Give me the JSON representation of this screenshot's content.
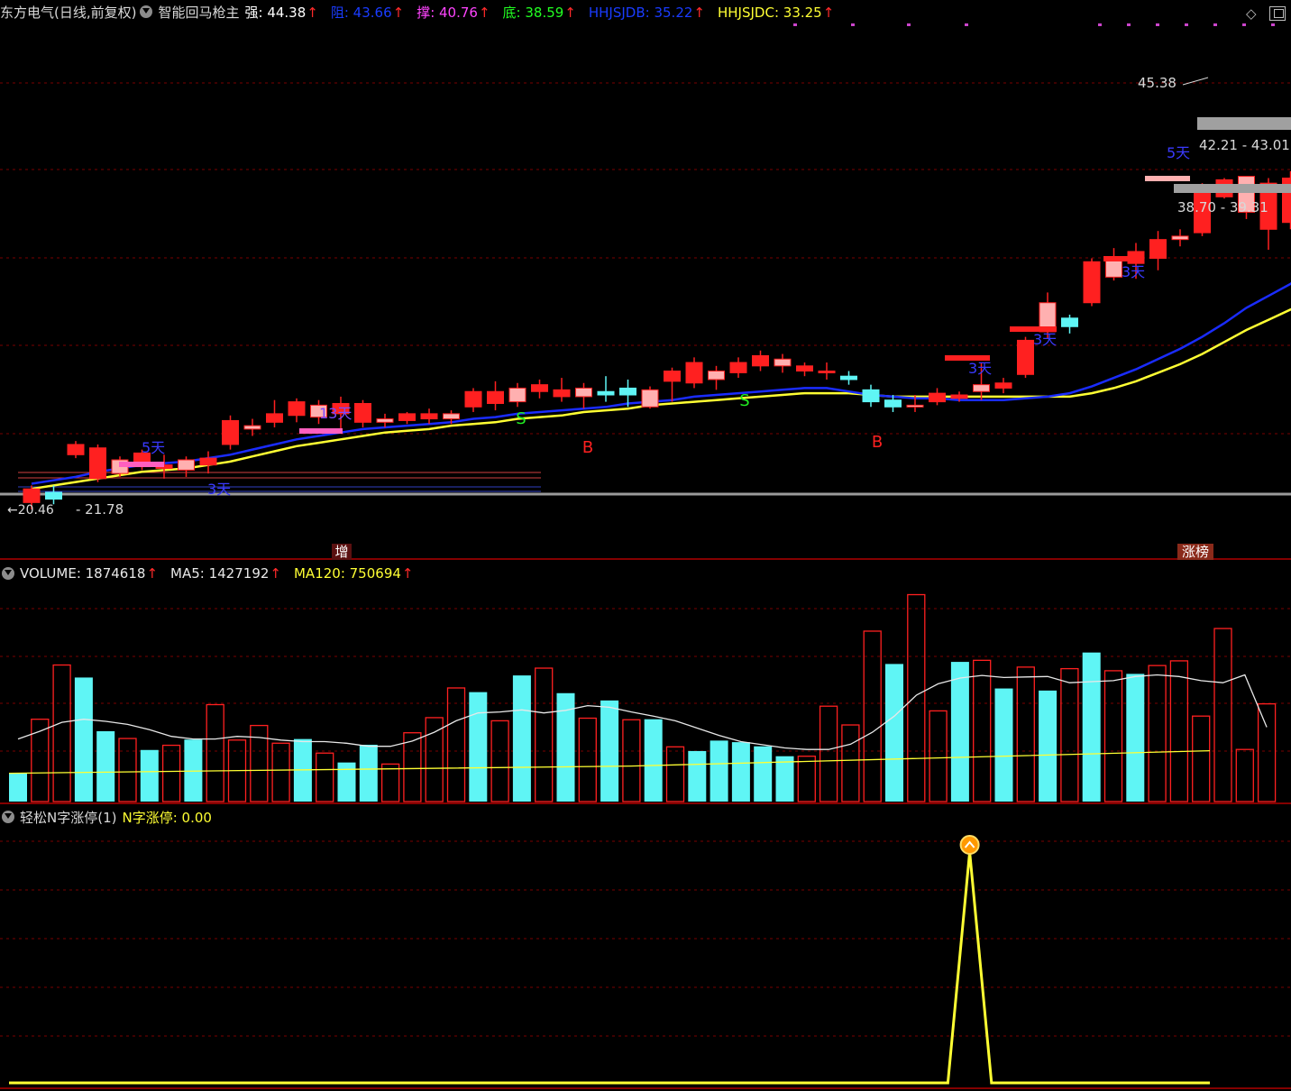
{
  "header": {
    "title": "东方电气(日线,前复权)",
    "indicator": "智能回马枪主",
    "items": [
      {
        "label": "强",
        "value": "44.38",
        "color": "#ffffff"
      },
      {
        "label": "阻",
        "value": "43.66",
        "color": "#1a3cff"
      },
      {
        "label": "撑",
        "value": "40.76",
        "color": "#ff44ff"
      },
      {
        "label": "底",
        "value": "38.59",
        "color": "#22ff22"
      },
      {
        "label": "HHJSJDB",
        "value": "35.22",
        "color": "#1a3cff"
      },
      {
        "label": "HHJSJDC",
        "value": "33.25",
        "color": "#ffff33"
      }
    ]
  },
  "volume_header": {
    "items": [
      {
        "label": "VOLUME",
        "value": "1874618",
        "color": "#e8e8e8"
      },
      {
        "label": "MA5",
        "value": "1427192",
        "color": "#e8e8e8"
      },
      {
        "label": "MA120",
        "value": "750694",
        "color": "#ffff33"
      }
    ]
  },
  "indicator_header": {
    "name": "轻松N字涨停(1)",
    "label": "N字涨停",
    "value": "0.00"
  },
  "annotations": {
    "high_price": "45.38",
    "low_price": "21.78",
    "low_price_overlap": "20.46",
    "zone_upper": "42.21 - 43.01",
    "zone_lower": "38.70 - 39.31",
    "day_labels": [
      "5天",
      "13天",
      "3天",
      "3天",
      "3天",
      "3天",
      "5天"
    ],
    "signals_b": [
      "B",
      "B"
    ],
    "signals_s": [
      "S",
      "S"
    ],
    "tag_zeng": "增",
    "tag_zhangbang": "涨榜"
  },
  "colors": {
    "up": "#ff2020",
    "up_light": "#ffb0b0",
    "down": "#5ff5f5",
    "ma_blue": "#1a2cff",
    "ma_yellow": "#ffff33",
    "grid": "#7a0000",
    "separator": "#b00000"
  },
  "icons": [
    "collapse-circle-icon",
    "diamond-icon",
    "maximize-icon",
    "up-arrow-icon"
  ],
  "chart_data": [
    {
      "type": "candlestick",
      "series": [
        {
          "name": "K线",
          "values": [
            [
              20.6,
              21.4,
              20.2,
              21.6
            ],
            [
              21.2,
              20.8,
              20.5,
              21.6
            ],
            [
              23.4,
              24.0,
              23.2,
              24.2
            ],
            [
              22.0,
              23.8,
              21.8,
              24.0
            ],
            [
              22.3,
              23.1,
              22.1,
              23.3
            ],
            [
              22.7,
              23.5,
              22.5,
              23.7
            ],
            [
              22.6,
              22.8,
              22.0,
              23.4
            ],
            [
              22.5,
              23.1,
              22.1,
              23.3
            ],
            [
              22.8,
              23.2,
              22.3,
              23.6
            ],
            [
              24.0,
              25.4,
              23.7,
              25.7
            ],
            [
              24.9,
              25.1,
              24.5,
              25.5
            ],
            [
              25.3,
              25.8,
              25.0,
              26.6
            ],
            [
              25.7,
              26.5,
              25.3,
              26.7
            ],
            [
              25.6,
              26.3,
              25.2,
              26.6
            ],
            [
              25.8,
              26.4,
              24.9,
              26.8
            ],
            [
              25.3,
              26.4,
              25.0,
              26.6
            ],
            [
              25.3,
              25.5,
              25.0,
              25.8
            ],
            [
              25.4,
              25.8,
              25.2,
              25.9
            ],
            [
              25.5,
              25.8,
              25.2,
              26.1
            ],
            [
              25.5,
              25.8,
              25.2,
              26.0
            ],
            [
              26.2,
              27.1,
              25.9,
              27.3
            ],
            [
              26.4,
              27.1,
              26.0,
              27.7
            ],
            [
              26.5,
              27.3,
              26.2,
              27.6
            ],
            [
              27.1,
              27.5,
              26.7,
              27.8
            ],
            [
              26.8,
              27.2,
              26.5,
              27.9
            ],
            [
              26.8,
              27.3,
              26.1,
              27.6
            ],
            [
              27.1,
              26.9,
              26.5,
              28.0
            ],
            [
              27.3,
              26.9,
              26.2,
              27.8
            ],
            [
              26.2,
              27.2,
              26.1,
              27.4
            ],
            [
              27.7,
              28.3,
              26.5,
              28.5
            ],
            [
              27.6,
              28.8,
              27.3,
              29.1
            ],
            [
              27.8,
              28.3,
              27.2,
              28.6
            ],
            [
              28.2,
              28.8,
              27.9,
              29.1
            ],
            [
              28.6,
              29.2,
              28.3,
              29.5
            ],
            [
              28.6,
              29.0,
              28.2,
              29.3
            ],
            [
              28.3,
              28.6,
              28.0,
              28.8
            ],
            [
              28.3,
              28.3,
              27.8,
              28.8
            ],
            [
              28.0,
              27.8,
              27.5,
              28.3
            ],
            [
              27.2,
              26.5,
              26.2,
              27.5
            ],
            [
              26.6,
              26.2,
              25.9,
              26.9
            ],
            [
              26.3,
              26.3,
              25.9,
              26.9
            ],
            [
              26.5,
              27.0,
              26.3,
              27.3
            ],
            [
              26.7,
              26.9,
              26.5,
              27.1
            ],
            [
              27.1,
              27.5,
              26.6,
              28.8
            ],
            [
              27.3,
              27.6,
              27.0,
              27.9
            ],
            [
              28.1,
              30.1,
              27.9,
              30.3
            ],
            [
              30.6,
              32.3,
              30.2,
              32.9
            ],
            [
              31.4,
              30.9,
              30.5,
              31.6
            ],
            [
              32.3,
              34.7,
              32.1,
              34.9
            ],
            [
              33.8,
              35.0,
              33.6,
              35.5
            ],
            [
              34.6,
              35.3,
              33.7,
              35.8
            ],
            [
              34.9,
              36.0,
              34.2,
              36.5
            ],
            [
              36.0,
              36.2,
              35.6,
              36.6
            ],
            [
              36.4,
              39.1,
              36.2,
              39.3
            ],
            [
              38.5,
              39.5,
              38.4,
              39.6
            ],
            [
              37.6,
              39.7,
              37.2,
              39.7
            ],
            [
              36.6,
              39.3,
              35.4,
              39.6
            ],
            [
              37.0,
              39.6,
              36.6,
              40.0
            ],
            [
              37.2,
              39.8,
              37.0,
              40.1
            ],
            [
              41.6,
              43.8,
              41.5,
              44.0
            ],
            [
              43.2,
              44.5,
              43.1,
              45.4
            ]
          ]
        }
      ],
      "ma_blue": [
        21.7,
        21.9,
        22.1,
        22.4,
        22.6,
        22.8,
        22.9,
        23.0,
        23.2,
        23.4,
        23.7,
        24.0,
        24.3,
        24.5,
        24.7,
        24.9,
        25.0,
        25.1,
        25.2,
        25.3,
        25.5,
        25.6,
        25.8,
        25.9,
        26.0,
        26.1,
        26.2,
        26.4,
        26.5,
        26.6,
        26.8,
        26.9,
        27.0,
        27.1,
        27.2,
        27.3,
        27.3,
        27.1,
        26.9,
        26.8,
        26.7,
        26.7,
        26.6,
        26.6,
        26.6,
        26.7,
        26.8,
        27.0,
        27.4,
        27.9,
        28.4,
        29.0,
        29.6,
        30.3,
        31.1,
        32.0,
        32.7,
        33.4,
        34.4,
        35.2
      ],
      "ma_yellow": [
        21.4,
        21.6,
        21.8,
        22.0,
        22.2,
        22.4,
        22.5,
        22.6,
        22.8,
        23.0,
        23.3,
        23.6,
        23.9,
        24.1,
        24.3,
        24.5,
        24.7,
        24.8,
        24.9,
        25.1,
        25.2,
        25.3,
        25.5,
        25.6,
        25.7,
        25.9,
        26.0,
        26.1,
        26.3,
        26.4,
        26.5,
        26.6,
        26.7,
        26.8,
        26.9,
        27.0,
        27.0,
        27.0,
        26.9,
        26.8,
        26.8,
        26.8,
        26.8,
        26.8,
        26.8,
        26.8,
        26.8,
        26.8,
        27.0,
        27.3,
        27.7,
        28.2,
        28.7,
        29.3,
        30.0,
        30.7,
        31.3,
        31.9,
        32.6,
        33.3
      ],
      "ylim": [
        20.46,
        45.38
      ]
    },
    {
      "type": "bar",
      "title": "VOLUME",
      "series": [
        {
          "name": "VOLUME",
          "values": [
            550000,
            1580000,
            2620000,
            2380000,
            1350000,
            1210000,
            990000,
            1080000,
            1190000,
            1860000,
            1180000,
            1460000,
            1120000,
            1200000,
            930000,
            750000,
            1090000,
            720000,
            1320000,
            1610000,
            2180000,
            2100000,
            1550000,
            2420000,
            2560000,
            2080000,
            1600000,
            1940000,
            1570000,
            1580000,
            1050000,
            970000,
            1170000,
            1140000,
            1060000,
            870000,
            870000,
            1830000,
            1470000,
            3270000,
            2640000,
            3970000,
            1740000,
            2680000,
            2710000,
            2170000,
            2580000,
            2130000,
            2550000,
            2860000,
            2510000,
            2450000,
            2610000,
            2700000,
            1640000,
            3320000,
            1000000,
            1874618
          ]
        }
      ],
      "ma5": [
        1200000,
        1350000,
        1520000,
        1580000,
        1540000,
        1480000,
        1380000,
        1250000,
        1200000,
        1200000,
        1250000,
        1230000,
        1180000,
        1150000,
        1150000,
        1120000,
        1060000,
        1060000,
        1160000,
        1330000,
        1550000,
        1700000,
        1720000,
        1760000,
        1700000,
        1750000,
        1840000,
        1810000,
        1720000,
        1640000,
        1550000,
        1410000,
        1270000,
        1150000,
        1090000,
        1030000,
        1000000,
        1000000,
        1100000,
        1330000,
        1640000,
        2040000,
        2260000,
        2370000,
        2420000,
        2380000,
        2390000,
        2400000,
        2280000,
        2300000,
        2320000,
        2400000,
        2430000,
        2400000,
        2320000,
        2280000,
        2430000,
        1427192
      ],
      "ma120": 750694
    },
    {
      "type": "line",
      "title": "轻松N字涨停(1)",
      "series": [
        {
          "name": "N字涨停",
          "values": [
            0,
            0,
            0,
            0,
            0,
            0,
            0,
            0,
            0,
            0,
            0,
            0,
            0,
            0,
            0,
            0,
            0,
            0,
            0,
            0,
            0,
            0,
            0,
            0,
            0,
            0,
            0,
            0,
            0,
            0,
            0,
            0,
            0,
            0,
            0,
            0,
            0,
            0,
            0,
            0,
            0,
            0,
            0,
            0,
            1,
            0,
            0,
            0,
            0,
            0,
            0,
            0,
            0,
            0,
            0,
            0
          ]
        }
      ],
      "ylim": [
        0,
        1
      ]
    }
  ]
}
